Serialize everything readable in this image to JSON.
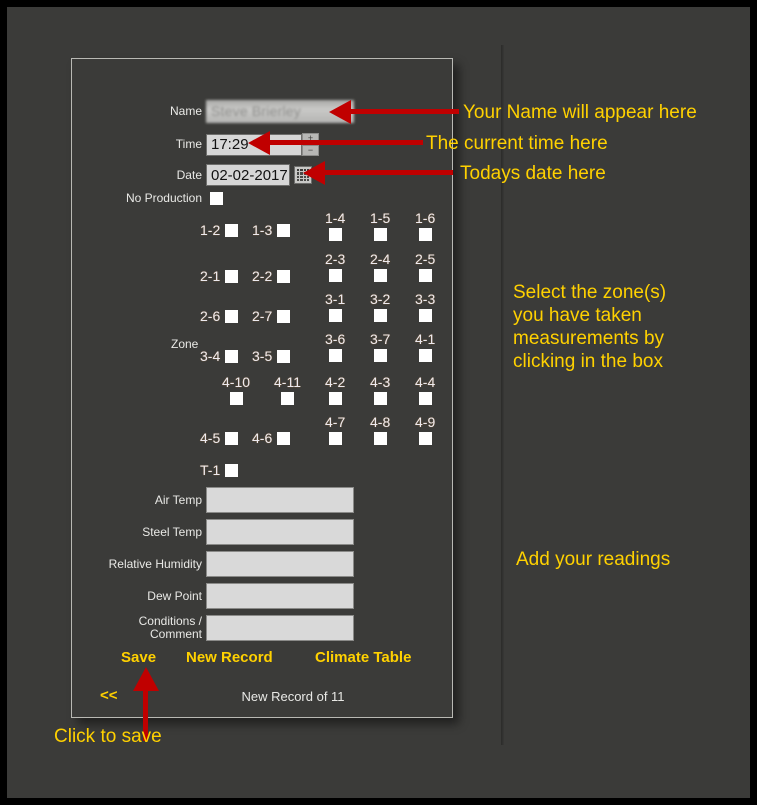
{
  "form": {
    "fields": {
      "name_label": "Name",
      "name_value": "Steve Brierley",
      "time_label": "Time",
      "time_value": "17:29",
      "time_increment": "+",
      "time_decrement": "−",
      "date_label": "Date",
      "date_value": "02-02-2017",
      "no_production_label": "No Production"
    },
    "zone_section_label": "Zone",
    "zone_rows": [
      {
        "style": "side",
        "cells": [
          "1-2",
          "1-3"
        ]
      },
      {
        "style": "top",
        "cells": [
          "1-4",
          "1-5",
          "1-6"
        ]
      },
      {
        "style": "side",
        "cells": [
          "2-1",
          "2-2"
        ]
      },
      {
        "style": "top",
        "cells": [
          "2-3",
          "2-4",
          "2-5"
        ]
      },
      {
        "style": "side",
        "cells": [
          "2-6",
          "2-7"
        ]
      },
      {
        "style": "top",
        "cells": [
          "3-1",
          "3-2",
          "3-3"
        ]
      },
      {
        "style": "side",
        "cells": [
          "3-4",
          "3-5"
        ]
      },
      {
        "style": "top",
        "cells": [
          "3-6",
          "3-7",
          "4-1"
        ]
      },
      {
        "style": "top5",
        "cells": [
          "4-10",
          "4-11",
          "4-2",
          "4-3",
          "4-4"
        ]
      },
      {
        "style": "side",
        "cells": [
          "4-5",
          "4-6"
        ]
      },
      {
        "style": "top",
        "cells": [
          "4-7",
          "4-8",
          "4-9"
        ]
      },
      {
        "style": "side",
        "cells": [
          "T-1"
        ]
      }
    ],
    "readings": [
      {
        "label": "Air Temp",
        "value": ""
      },
      {
        "label": "Steel Temp",
        "value": ""
      },
      {
        "label": "Relative Humidity",
        "value": ""
      },
      {
        "label": "Dew Point",
        "value": ""
      },
      {
        "label": "Conditions /\nComment",
        "value": ""
      }
    ],
    "actions": {
      "save": "Save",
      "new_record": "New Record",
      "climate_table": "Climate Table",
      "previous": "<<"
    },
    "record_status": "New Record of 11"
  },
  "annotations": {
    "name_note": "Your Name will appear here",
    "time_note": "The current time here",
    "date_note": "Todays date here",
    "zone_note": "Select the zone(s)\nyou have taken\nmeasurements by\nclicking in the box",
    "readings_note": "Add your readings",
    "save_note": "Click to save"
  },
  "colors": {
    "background": "#3b3b39",
    "accent_yellow": "#ffd100",
    "arrow_red": "#c00000",
    "input_fill": "#d9d9d9",
    "panel_border": "#b9b9b4"
  }
}
